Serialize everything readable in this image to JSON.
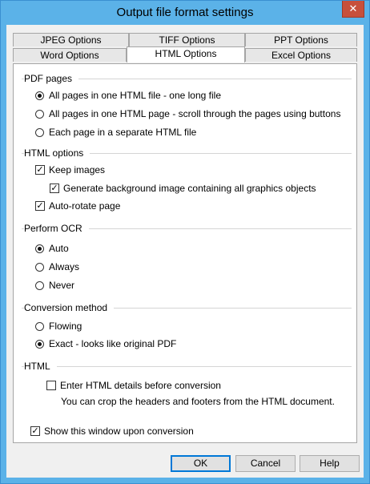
{
  "window": {
    "title": "Output file format settings",
    "close_glyph": "✕"
  },
  "tabs": {
    "row_top": [
      "JPEG Options",
      "TIFF Options",
      "PPT Options"
    ],
    "row_bottom": [
      "Word Options",
      "HTML Options",
      "Excel Options"
    ],
    "active": "HTML Options"
  },
  "pdf_pages": {
    "title": "PDF pages",
    "options": [
      "All pages in one HTML file - one long file",
      "All pages in one HTML page - scroll through the pages using buttons",
      "Each page in a separate HTML file"
    ],
    "selected": 0
  },
  "html_options": {
    "title": "HTML options",
    "keep_images": "Keep images",
    "background_image": "Generate background image containing all graphics objects",
    "auto_rotate": "Auto-rotate page"
  },
  "ocr": {
    "title": "Perform OCR",
    "options": [
      "Auto",
      "Always",
      "Never"
    ],
    "selected": 0
  },
  "conversion": {
    "title": "Conversion method",
    "options": [
      "Flowing",
      "Exact - looks like original PDF"
    ],
    "selected": 1
  },
  "html": {
    "title": "HTML",
    "enter_details": "Enter HTML details before conversion",
    "crop_note": "You can crop the headers and footers from the HTML document."
  },
  "show_window": "Show this window upon conversion",
  "check_glyph": "✓",
  "buttons": {
    "ok": "OK",
    "cancel": "Cancel",
    "help": "Help"
  }
}
